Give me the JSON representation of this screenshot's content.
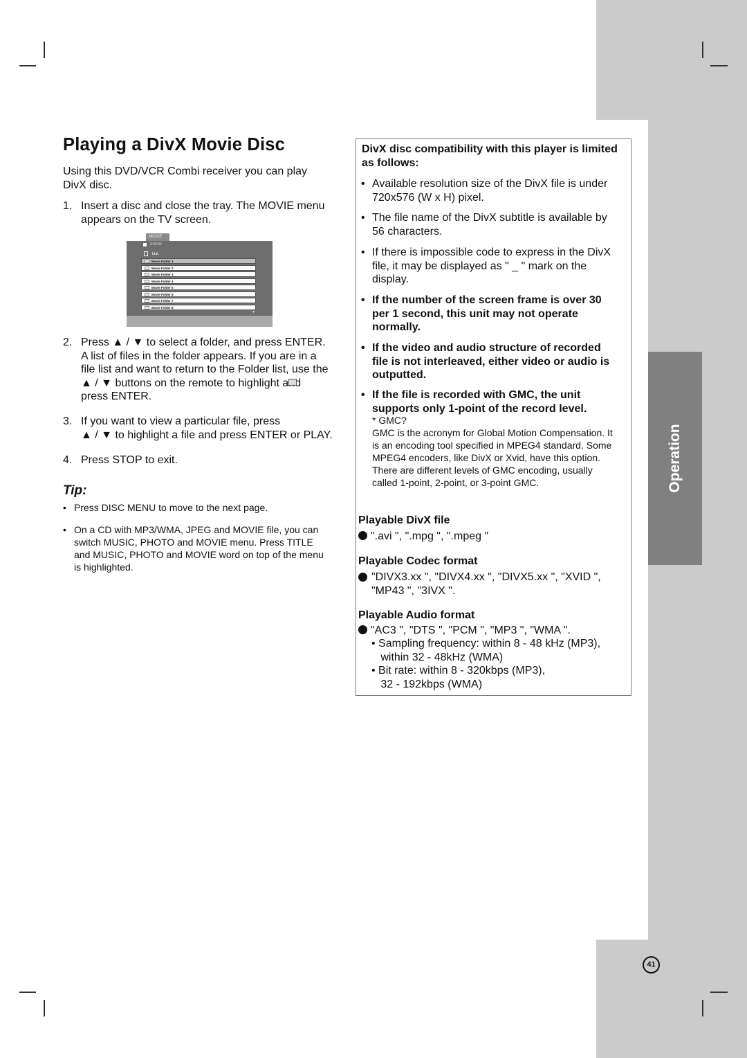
{
  "title": "Playing a DivX Movie Disc",
  "intro": "Using this DVD/VCR Combi receiver you can play\nDivX disc.",
  "steps": [
    {
      "n": "1.",
      "text": "Insert a disc and close the tray. The MOVIE menu\nappears on the TV screen."
    },
    {
      "n": "2.",
      "text": "Press ▲ / ▼ to select a folder, and press ENTER.\nA list of files in the folder appears. If you are in a\nfile list and want to return to the Folder list, use the\n▲ / ▼ buttons on the remote to highlight       and\npress ENTER."
    },
    {
      "n": "3.",
      "text": "If you want to view a particular file, press\n▲ / ▼ to highlight a file and press ENTER or PLAY."
    },
    {
      "n": "4.",
      "text": "Press STOP to exit."
    }
  ],
  "menu": {
    "tab": "MOVIE",
    "time": "0:00:00",
    "list_label": "List",
    "folders": [
      "Movie Folder 1",
      "Movie Folder 2",
      "Movie Folder 3",
      "Movie Folder 4",
      "Movie Folder 5",
      "Movie Folder 6",
      "Movie Folder 7",
      "Movie Folder 8"
    ]
  },
  "tip": {
    "heading": "Tip:",
    "items": [
      "Press DISC MENU to move to the next page.",
      "On a CD with MP3/WMA, JPEG and MOVIE file, you can\nswitch MUSIC, PHOTO and MOVIE menu. Press TITLE\nand MUSIC, PHOTO and MOVIE word on top of the menu\nis highlighted."
    ]
  },
  "compat": {
    "heading": "DivX disc compatibility with this player is limited\nas follows:",
    "items": [
      {
        "text": "Available resolution size of the DivX file is under\n720x576 (W x H) pixel.",
        "bold": false
      },
      {
        "text": "The file name of the DivX subtitle is available by\n56 characters.",
        "bold": false
      },
      {
        "text": "If there is impossible code to express in the DivX\nfile, it may be displayed as  \" _ \" mark on the\ndisplay.",
        "bold": false
      },
      {
        "text": "If the number of the screen frame is over 30\nper 1 second, this unit may not operate\nnormally.",
        "bold": true
      },
      {
        "text": "If the video and audio structure of recorded\nfile is not interleaved, either video or audio is\noutputted.",
        "bold": true
      },
      {
        "text": "If the file is recorded with GMC, the unit\nsupports only 1-point of the record level.",
        "bold": true
      }
    ],
    "gmc_q": "* GMC?",
    "gmc_text": "GMC is the acronym for Global Motion Compensation. It\nis an encoding tool specified in MPEG4 standard. Some\nMPEG4 encoders, like DivX or Xvid, have this option.\nThere are different levels of GMC encoding, usually\ncalled 1-point, 2-point, or 3-point GMC."
  },
  "playable_file": {
    "heading": "Playable DivX file",
    "text": "\".avi \", \".mpg \", \".mpeg \""
  },
  "codec": {
    "heading": "Playable Codec format",
    "text": "\"DIVX3.xx \", \"DIVX4.xx \", \"DIVX5.xx \", \"XVID \",\n\"MP43 \", \"3IVX \"."
  },
  "audio": {
    "heading": "Playable Audio format",
    "text": "\"AC3 \", \"DTS \", \"PCM \", \"MP3 \", \"WMA \".",
    "sub": [
      "• Sampling frequency: within 8 - 48 kHz (MP3),\n   within 32 - 48kHz (WMA)",
      "• Bit rate: within 8 - 320kbps (MP3),\n   32 - 192kbps (WMA)"
    ]
  },
  "side_tab": "Operation",
  "page_number": "41"
}
